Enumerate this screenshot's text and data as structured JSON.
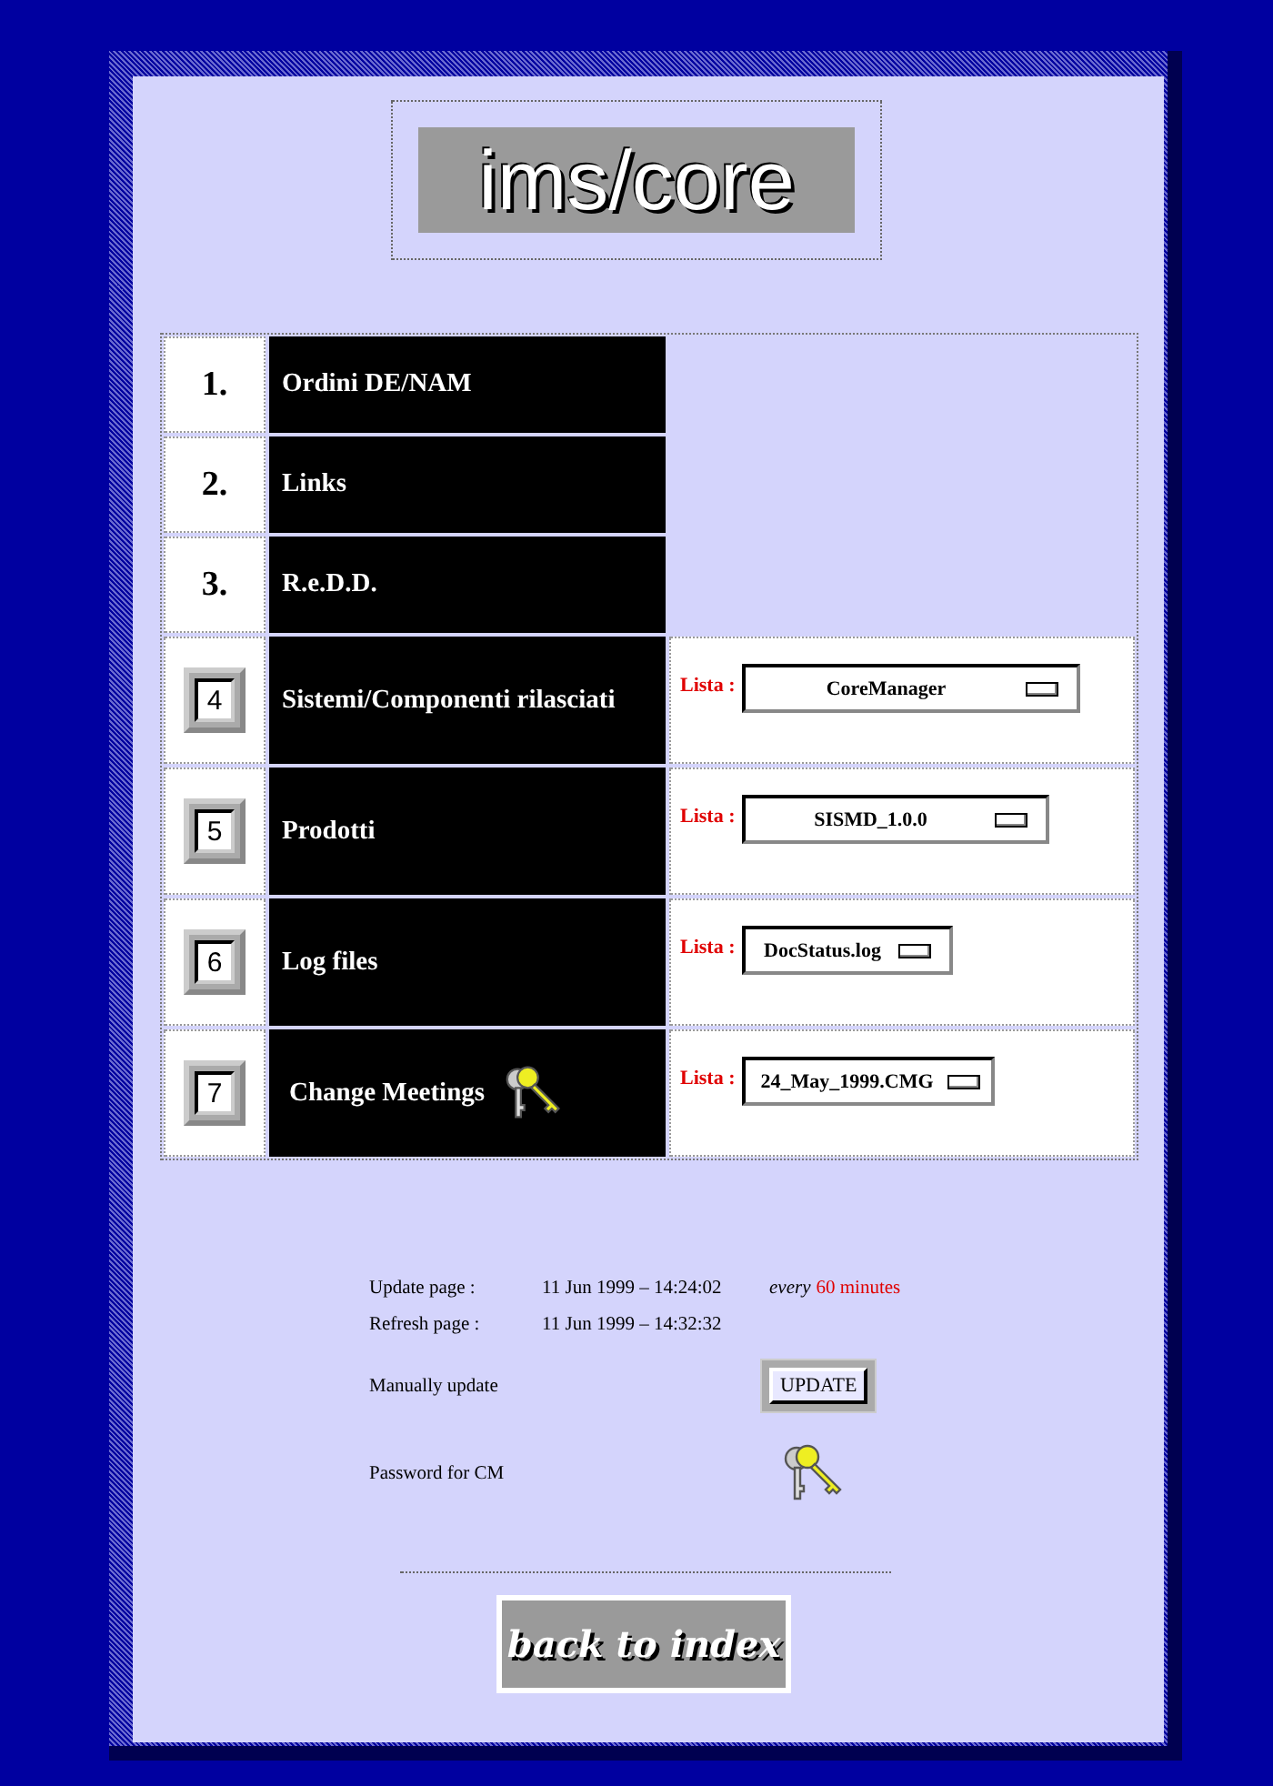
{
  "logo": "ims/core",
  "menu": [
    {
      "number": "1.",
      "kind": "plain",
      "label": "Ordini DE/NAM",
      "key_icon": false
    },
    {
      "number": "2.",
      "kind": "plain",
      "label": "Links",
      "key_icon": false
    },
    {
      "number": "3.",
      "kind": "plain",
      "label": "R.e.D.D.",
      "key_icon": false
    },
    {
      "number": "4",
      "kind": "button",
      "label": "Sistemi/Componenti rilasciati",
      "key_icon": false,
      "list": {
        "label": "Lista :",
        "value": "CoreManager"
      }
    },
    {
      "number": "5",
      "kind": "button",
      "label": "Prodotti",
      "key_icon": false,
      "list": {
        "label": "Lista :",
        "value": "SISMD_1.0.0"
      }
    },
    {
      "number": "6",
      "kind": "button",
      "label": "Log files",
      "key_icon": false,
      "list": {
        "label": "Lista :",
        "value": "DocStatus.log"
      }
    },
    {
      "number": "7",
      "kind": "button",
      "label": "Change Meetings",
      "key_icon": true,
      "list": {
        "label": "Lista :",
        "value": "24_May_1999.CMG"
      }
    }
  ],
  "update_page": {
    "label": "Update page :",
    "value": "11 Jun 1999 – 14:24:02",
    "every": "every",
    "interval": "60 minutes"
  },
  "refresh_page": {
    "label": "Refresh page :",
    "value": "11 Jun 1999 – 14:32:32"
  },
  "manual_update": {
    "label": "Manually update",
    "button": "UPDATE"
  },
  "password": {
    "label": "Password for CM"
  },
  "back_button": "back to index"
}
